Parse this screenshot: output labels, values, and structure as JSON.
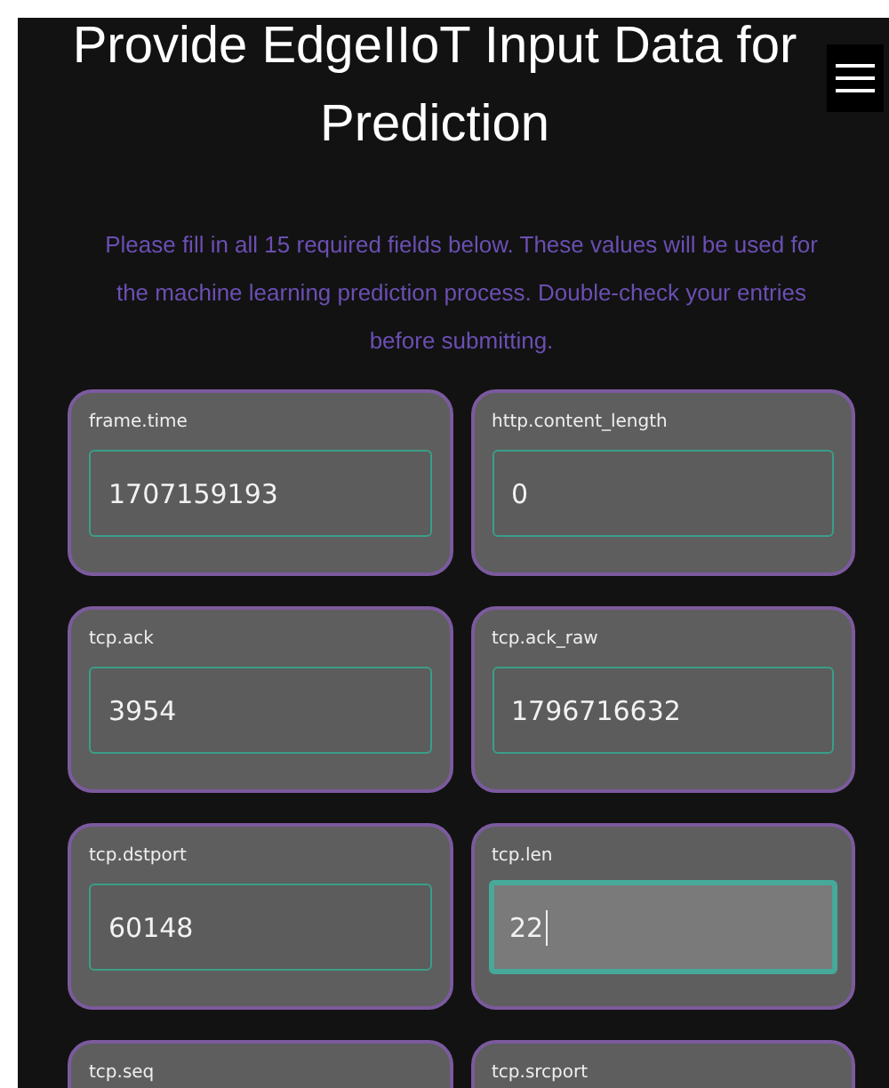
{
  "title": "Provide EdgeIIoT Input Data for Prediction",
  "description": "Please fill in all 15 required fields below. These values will be used for the machine learning prediction process. Double-check your entries before submitting.",
  "fields": [
    {
      "label": "frame.time",
      "value": "1707159193",
      "focused": false
    },
    {
      "label": "http.content_length",
      "value": "0",
      "focused": false
    },
    {
      "label": "tcp.ack",
      "value": "3954",
      "focused": false
    },
    {
      "label": "tcp.ack_raw",
      "value": "1796716632",
      "focused": false
    },
    {
      "label": "tcp.dstport",
      "value": "60148",
      "focused": false
    },
    {
      "label": "tcp.len",
      "value": "22",
      "focused": true
    },
    {
      "label": "tcp.seq"
    },
    {
      "label": "tcp.srcport"
    }
  ]
}
